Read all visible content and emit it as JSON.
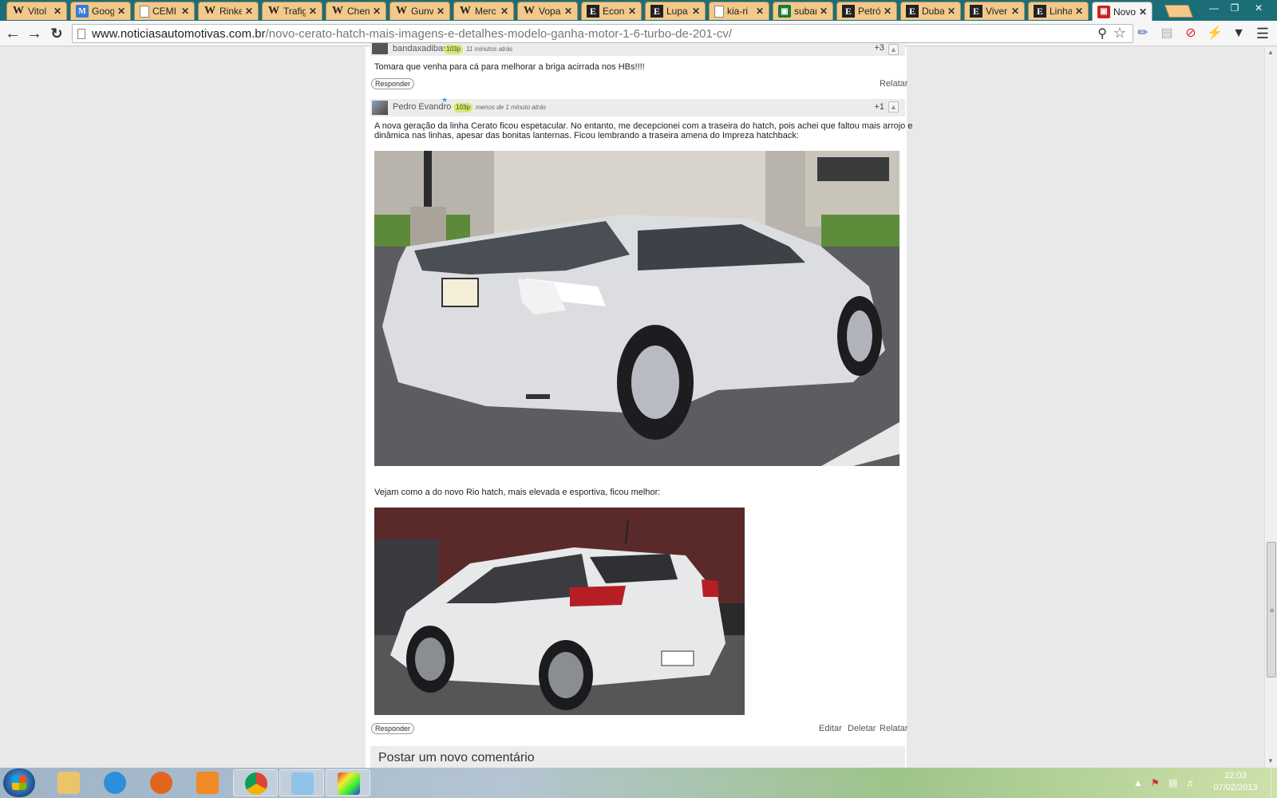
{
  "browser": {
    "tabs": [
      {
        "title": "Vitol",
        "icon": "W"
      },
      {
        "title": "Goog",
        "icon": "gm"
      },
      {
        "title": "CEMI",
        "icon": "doc"
      },
      {
        "title": "Rinke",
        "icon": "W"
      },
      {
        "title": "Trafig",
        "icon": "W"
      },
      {
        "title": "Chen",
        "icon": "W"
      },
      {
        "title": "Gunv",
        "icon": "W"
      },
      {
        "title": "Merc",
        "icon": "W"
      },
      {
        "title": "Vopa",
        "icon": "W"
      },
      {
        "title": "Econ",
        "icon": "E"
      },
      {
        "title": "Lupa",
        "icon": "E"
      },
      {
        "title": "kia-ri",
        "icon": "doc"
      },
      {
        "title": "subar",
        "icon": "car"
      },
      {
        "title": "Petró",
        "icon": "E"
      },
      {
        "title": "Duba",
        "icon": "E"
      },
      {
        "title": "Viver",
        "icon": "E"
      },
      {
        "title": "Linha",
        "icon": "E"
      },
      {
        "title": "Novo",
        "icon": "news",
        "active": true
      }
    ],
    "url_domain": "www.noticiasautomotivas.com.br",
    "url_path": "/novo-cerato-hatch-mais-imagens-e-detalhes-modelo-ganha-motor-1-6-turbo-de-201-cv/"
  },
  "comments": [
    {
      "author": "bandaxadibar",
      "points": "103p",
      "time": "11 minutos atrás",
      "votes": "+3",
      "text": "Tomara que venha para cá para melhorar a briga acirrada nos HBs!!!!",
      "reply": "Responder",
      "report": "Relatar"
    },
    {
      "author": "Pedro Evandro",
      "points": "103p",
      "time": "menos de 1 minuto atrás",
      "votes": "+1",
      "text1": "A nova geração da linha Cerato ficou espetacular. No entanto, me decepcionei com a traseira do hatch, pois achei que faltou mais arrojo e",
      "text2": "dinâmica nas linhas, apesar das bonitas lanternas. Ficou lembrando a traseira amena do Impreza hatchback:",
      "text3": "Vejam como a do novo Rio hatch, mais elevada e esportiva, ficou melhor:",
      "reply": "Responder",
      "edit": "Editar",
      "delete": "Deletar",
      "report": "Relatar"
    }
  ],
  "new_comment_title": "Postar um novo comentário",
  "taskbar": {
    "time": "22:03",
    "date": "07/02/2013"
  }
}
